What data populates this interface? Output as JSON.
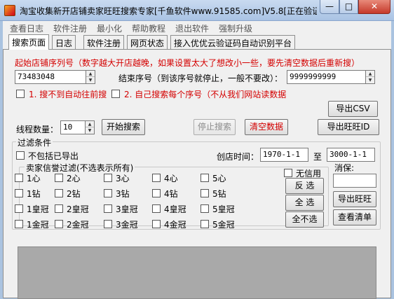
{
  "window": {
    "title": "淘宝收集新开店铺卖家旺旺搜索专家[千鱼软件www.91585.com]V5.8[正在验证...",
    "min_glyph": "—",
    "max_glyph": "□",
    "close_glyph": "✕"
  },
  "menu": [
    "查看日志",
    "软件注册",
    "最小化",
    "帮助教程",
    "退出软件",
    "强制升级"
  ],
  "tabs": [
    "搜索页面",
    "日志",
    "软件注册",
    "网页状态",
    "接入优优云验证码自动识别平台"
  ],
  "notice": "起始店铺序列号（数字越大开店越晚，如果设置太大了想改小一些，要先清空数据后重新搜）",
  "start_seq": {
    "value": "73483048"
  },
  "end_seq": {
    "label": "结束序号（到该序号就停止，一般不要改）：",
    "value": "9999999999"
  },
  "options": {
    "auto_forward": "1. 搜不到自动往前搜",
    "manual_each": "2. 自己搜索每个序号（不从我们网站读数据"
  },
  "threads": {
    "label": "线程数量：",
    "value": "10"
  },
  "buttons": {
    "export_csv": "导出CSV",
    "start": "开始搜索",
    "stop": "停止搜索",
    "clear": "清空数据",
    "export_wangwang_id": "导出旺旺ID",
    "invert": "反 选",
    "select_all": "全 选",
    "select_none": "全不选",
    "export_wangwang": "导出旺旺",
    "view_list": "查看清单"
  },
  "filter": {
    "legend": "过滤条件",
    "exclude_exported": "不包括已导出",
    "shop_time_label": "创店时间：",
    "date_from": "1970-1-1",
    "to": "至",
    "date_to": "3000-1-1"
  },
  "credit": {
    "legend": "卖家信誉过滤(不选表示所有)",
    "no_credit": "无信用",
    "grid": [
      [
        "1心",
        "2心",
        "3心",
        "4心",
        "5心"
      ],
      [
        "1钻",
        "2钻",
        "3钻",
        "4钻",
        "5钻"
      ],
      [
        "1皇冠",
        "2皇冠",
        "3皇冠",
        "4皇冠",
        "5皇冠"
      ],
      [
        "1金冠",
        "2金冠",
        "3金冠",
        "4金冠",
        "5金冠"
      ]
    ]
  },
  "deposit": {
    "label": "消保:",
    "value": ""
  }
}
